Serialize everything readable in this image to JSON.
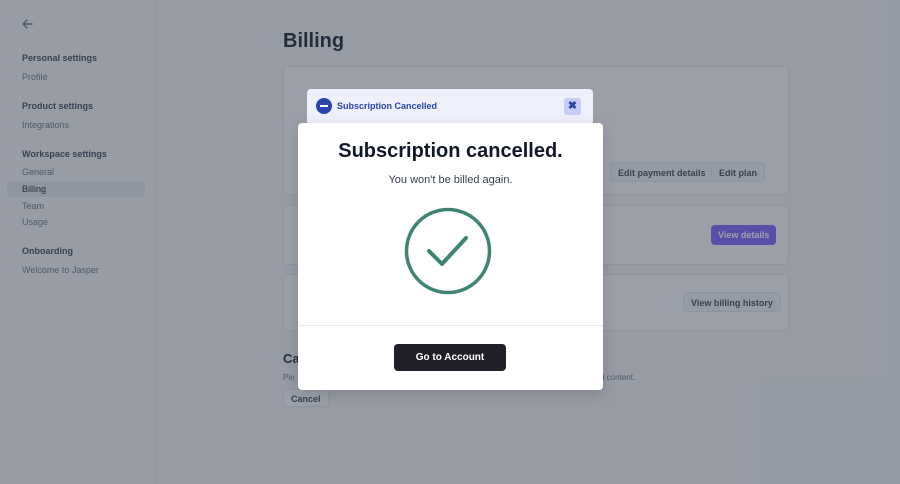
{
  "sidebar": {
    "sections": [
      {
        "title": "Personal settings",
        "items": [
          "Profile"
        ]
      },
      {
        "title": "Product settings",
        "items": [
          "Integrations"
        ]
      },
      {
        "title": "Workspace settings",
        "items": [
          "General",
          "Billing",
          "Team",
          "Usage"
        ]
      },
      {
        "title": "Onboarding",
        "items": [
          "Welcome to Jasper"
        ]
      }
    ],
    "active_item": "Billing"
  },
  "main": {
    "page_title": "Billing",
    "buttons": {
      "edit_payment": "Edit payment details",
      "edit_plan": "Edit plan",
      "view_details": "View details",
      "view_history": "View billing history"
    },
    "cancel_section": {
      "heading": "Ca",
      "desc_start": "Ple",
      "desc_end": "d content.",
      "button": "Cancel"
    }
  },
  "toast": {
    "icon": "minus-circle-icon",
    "text": "Subscription Cancelled",
    "close_icon": "close-icon"
  },
  "modal": {
    "title": "Subscription cancelled.",
    "subtitle": "You won't be billed again.",
    "icon": "check-circle-icon",
    "button": "Go to Account"
  },
  "colors": {
    "accent": "#7c5cff",
    "toast_text": "#2c44a8",
    "check_color": "#3f8374",
    "primary_button": "#1f2028"
  }
}
